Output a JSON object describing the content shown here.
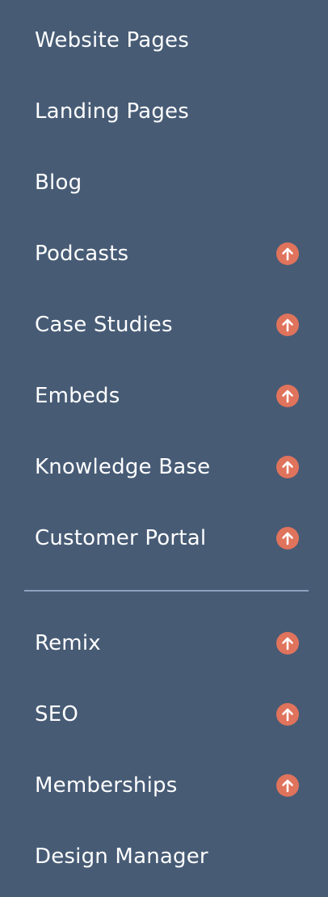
{
  "menu": {
    "group1": [
      {
        "label": "Website Pages",
        "upgrade": false
      },
      {
        "label": "Landing Pages",
        "upgrade": false
      },
      {
        "label": "Blog",
        "upgrade": false
      },
      {
        "label": "Podcasts",
        "upgrade": true
      },
      {
        "label": "Case Studies",
        "upgrade": true
      },
      {
        "label": "Embeds",
        "upgrade": true
      },
      {
        "label": "Knowledge Base",
        "upgrade": true
      },
      {
        "label": "Customer Portal",
        "upgrade": true
      }
    ],
    "group2": [
      {
        "label": "Remix",
        "upgrade": true
      },
      {
        "label": "SEO",
        "upgrade": true
      },
      {
        "label": "Memberships",
        "upgrade": true
      },
      {
        "label": "Design Manager",
        "upgrade": false
      }
    ]
  },
  "colors": {
    "background": "#475b75",
    "text": "#ffffff",
    "upgrade_badge": "#e0735c",
    "divider": "#8ea1bd"
  },
  "icons": {
    "upgrade": "arrow-up-circle-icon"
  }
}
